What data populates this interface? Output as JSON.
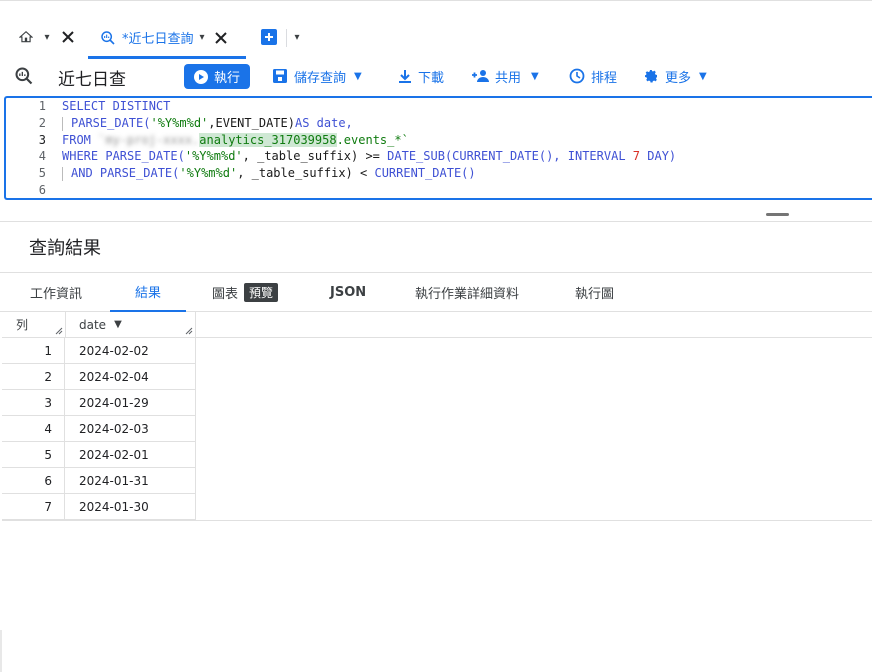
{
  "tabs": {
    "home_menu": "▾",
    "active_tab_label": "*近七日查詢",
    "active_tab_menu": "▾",
    "new_tab_menu": "▾"
  },
  "toolbar": {
    "query_title": "近七日查",
    "run_label": "執行",
    "save_label": "儲存查詢",
    "download_label": "下載",
    "share_label": "共用",
    "schedule_label": "排程",
    "more_label": "更多"
  },
  "editor": {
    "line_numbers": [
      "1",
      "2",
      "3",
      "4",
      "5",
      "6"
    ],
    "lines": [
      "SELECT DISTINCT",
      "  PARSE_DATE('%Y%m%d',EVENT_DATE)AS date,",
      "FROM `...analytics_317039958.events_*`",
      "WHERE PARSE_DATE('%Y%m%d', _table_suffix) >= DATE_SUB(CURRENT_DATE(), INTERVAL 7 DAY)",
      "  AND PARSE_DATE('%Y%m%d', _table_suffix) < CURRENT_DATE()",
      ""
    ],
    "l1_kw": "SELECT DISTINCT",
    "l2_fn": "PARSE_DATE(",
    "l2_str": "'%Y%m%d'",
    "l2_rest": ",EVENT_DATE)",
    "l2_as": "AS",
    "l2_alias": " date,",
    "l3_kw": "FROM",
    "l3_dataset": "analytics_317039958",
    "l3_rest": ".events_*`",
    "l4_where": "WHERE",
    "l4_fn": "PARSE_DATE(",
    "l4_str": "'%Y%m%d'",
    "l4_mid": ", _table_suffix) >= ",
    "l4_fn2": "DATE_SUB(CURRENT_DATE(),",
    "l4_interval": " INTERVAL",
    "l4_num": " 7",
    "l4_day": " DAY)",
    "l5_and": "AND",
    "l5_fn": " PARSE_DATE(",
    "l5_str": "'%Y%m%d'",
    "l5_mid": ", _table_suffix) < ",
    "l5_fn2": "CURRENT_DATE()"
  },
  "results": {
    "title": "查詢結果",
    "tabs": [
      "工作資訊",
      "結果",
      "圖表",
      "JSON",
      "執行作業詳細資料",
      "執行圖"
    ],
    "preview_badge": "預覽",
    "columns": [
      "列",
      "date"
    ],
    "rows": [
      {
        "n": "1",
        "date": "2024-02-02"
      },
      {
        "n": "2",
        "date": "2024-02-04"
      },
      {
        "n": "3",
        "date": "2024-01-29"
      },
      {
        "n": "4",
        "date": "2024-02-03"
      },
      {
        "n": "5",
        "date": "2024-02-01"
      },
      {
        "n": "6",
        "date": "2024-01-31"
      },
      {
        "n": "7",
        "date": "2024-01-30"
      }
    ]
  },
  "colors": {
    "accent": "#1a73e8",
    "keyword": "#3f51d4",
    "string": "#0f7b0f",
    "number": "#d93025"
  }
}
